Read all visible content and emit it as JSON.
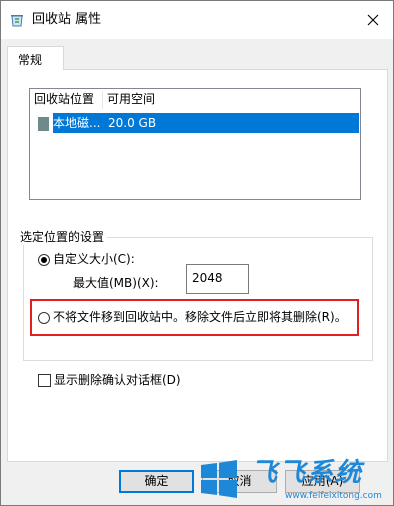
{
  "window": {
    "title": "回收站 属性",
    "icon": "recycle-bin-icon",
    "close_icon": "close-icon"
  },
  "tabs": [
    {
      "label": "常规",
      "selected": true
    }
  ],
  "list": {
    "columns": [
      "回收站位置",
      "可用空间"
    ],
    "rows": [
      {
        "location": "本地磁...",
        "free_space": "20.0 GB",
        "selected": true,
        "icon": "drive-icon"
      }
    ]
  },
  "settings": {
    "group_title": "选定位置的设置",
    "custom_size_label": "自定义大小(C):",
    "custom_size_selected": true,
    "max_size_label": "最大值(MB)(X):",
    "max_size_value": "2048",
    "no_recycle_label": "不将文件移到回收站中。移除文件后立即将其删除(R)。",
    "no_recycle_selected": false
  },
  "confirm_delete": {
    "label": "显示删除确认对话框(D)",
    "checked": false
  },
  "buttons": {
    "ok": "确定",
    "cancel": "取消",
    "apply": "应用(A)"
  },
  "watermark": {
    "text": "飞飞系统",
    "url": "www.feifeixitong.com"
  },
  "colors": {
    "selection": "#0078d7",
    "highlight_box": "#e02020",
    "watermark": "#1e88d8"
  }
}
